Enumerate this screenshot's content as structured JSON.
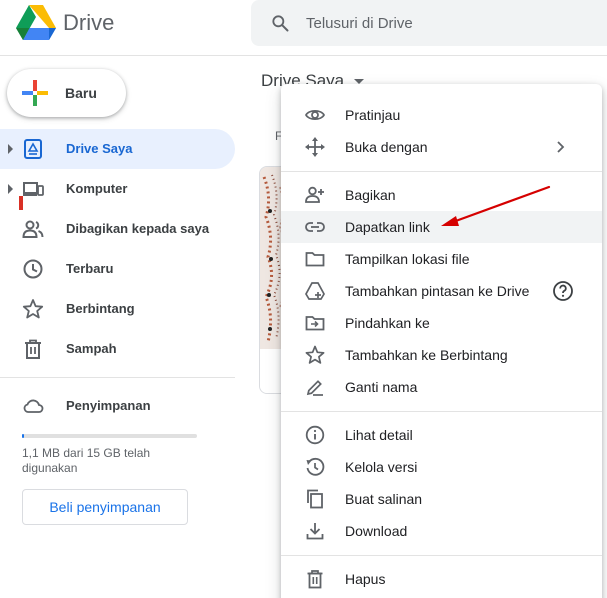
{
  "app": {
    "brand": "Drive"
  },
  "search": {
    "placeholder": "Telusuri di Drive"
  },
  "sidebar": {
    "new_label": "Baru",
    "items": [
      {
        "label": "Drive Saya",
        "icon": "my-drive-icon",
        "active": true,
        "expandable": true
      },
      {
        "label": "Komputer",
        "icon": "computer-icon",
        "active": false,
        "expandable": true
      },
      {
        "label": "Dibagikan kepada saya",
        "icon": "people-icon",
        "active": false,
        "expandable": false
      },
      {
        "label": "Terbaru",
        "icon": "clock-icon",
        "active": false,
        "expandable": false
      },
      {
        "label": "Berbintang",
        "icon": "star-icon",
        "active": false,
        "expandable": false
      },
      {
        "label": "Sampah",
        "icon": "trash-icon",
        "active": false,
        "expandable": false
      }
    ],
    "storage": {
      "label": "Penyimpanan",
      "usage_text": "1,1 MB dari 15 GB telah digunakan",
      "used_fraction": 0.0001,
      "buy_label": "Beli penyimpanan"
    }
  },
  "main": {
    "title": "Drive Saya",
    "filter_fragment": "F"
  },
  "context_menu": {
    "groups": [
      [
        {
          "label": "Pratinjau",
          "icon": "eye-icon"
        },
        {
          "label": "Buka dengan",
          "icon": "move-arrows-icon",
          "submenu": true
        }
      ],
      [
        {
          "label": "Bagikan",
          "icon": "person-add-icon"
        },
        {
          "label": "Dapatkan link",
          "icon": "link-icon",
          "highlighted": true
        },
        {
          "label": "Tampilkan lokasi file",
          "icon": "folder-icon"
        },
        {
          "label": "Tambahkan pintasan ke Drive",
          "icon": "add-shortcut-icon",
          "help": true
        },
        {
          "label": "Pindahkan ke",
          "icon": "move-to-folder-icon"
        },
        {
          "label": "Tambahkan ke Berbintang",
          "icon": "star-outline-icon"
        },
        {
          "label": "Ganti nama",
          "icon": "pencil-icon"
        }
      ],
      [
        {
          "label": "Lihat detail",
          "icon": "info-icon"
        },
        {
          "label": "Kelola versi",
          "icon": "history-icon"
        },
        {
          "label": "Buat salinan",
          "icon": "copy-icon"
        },
        {
          "label": "Download",
          "icon": "download-icon"
        }
      ],
      [
        {
          "label": "Hapus",
          "icon": "trash-icon"
        }
      ]
    ]
  },
  "colors": {
    "accent": "#1a73e8",
    "active_bg": "#e8f0fe",
    "active_text": "#1967d2",
    "annotation_arrow": "#d50000"
  }
}
